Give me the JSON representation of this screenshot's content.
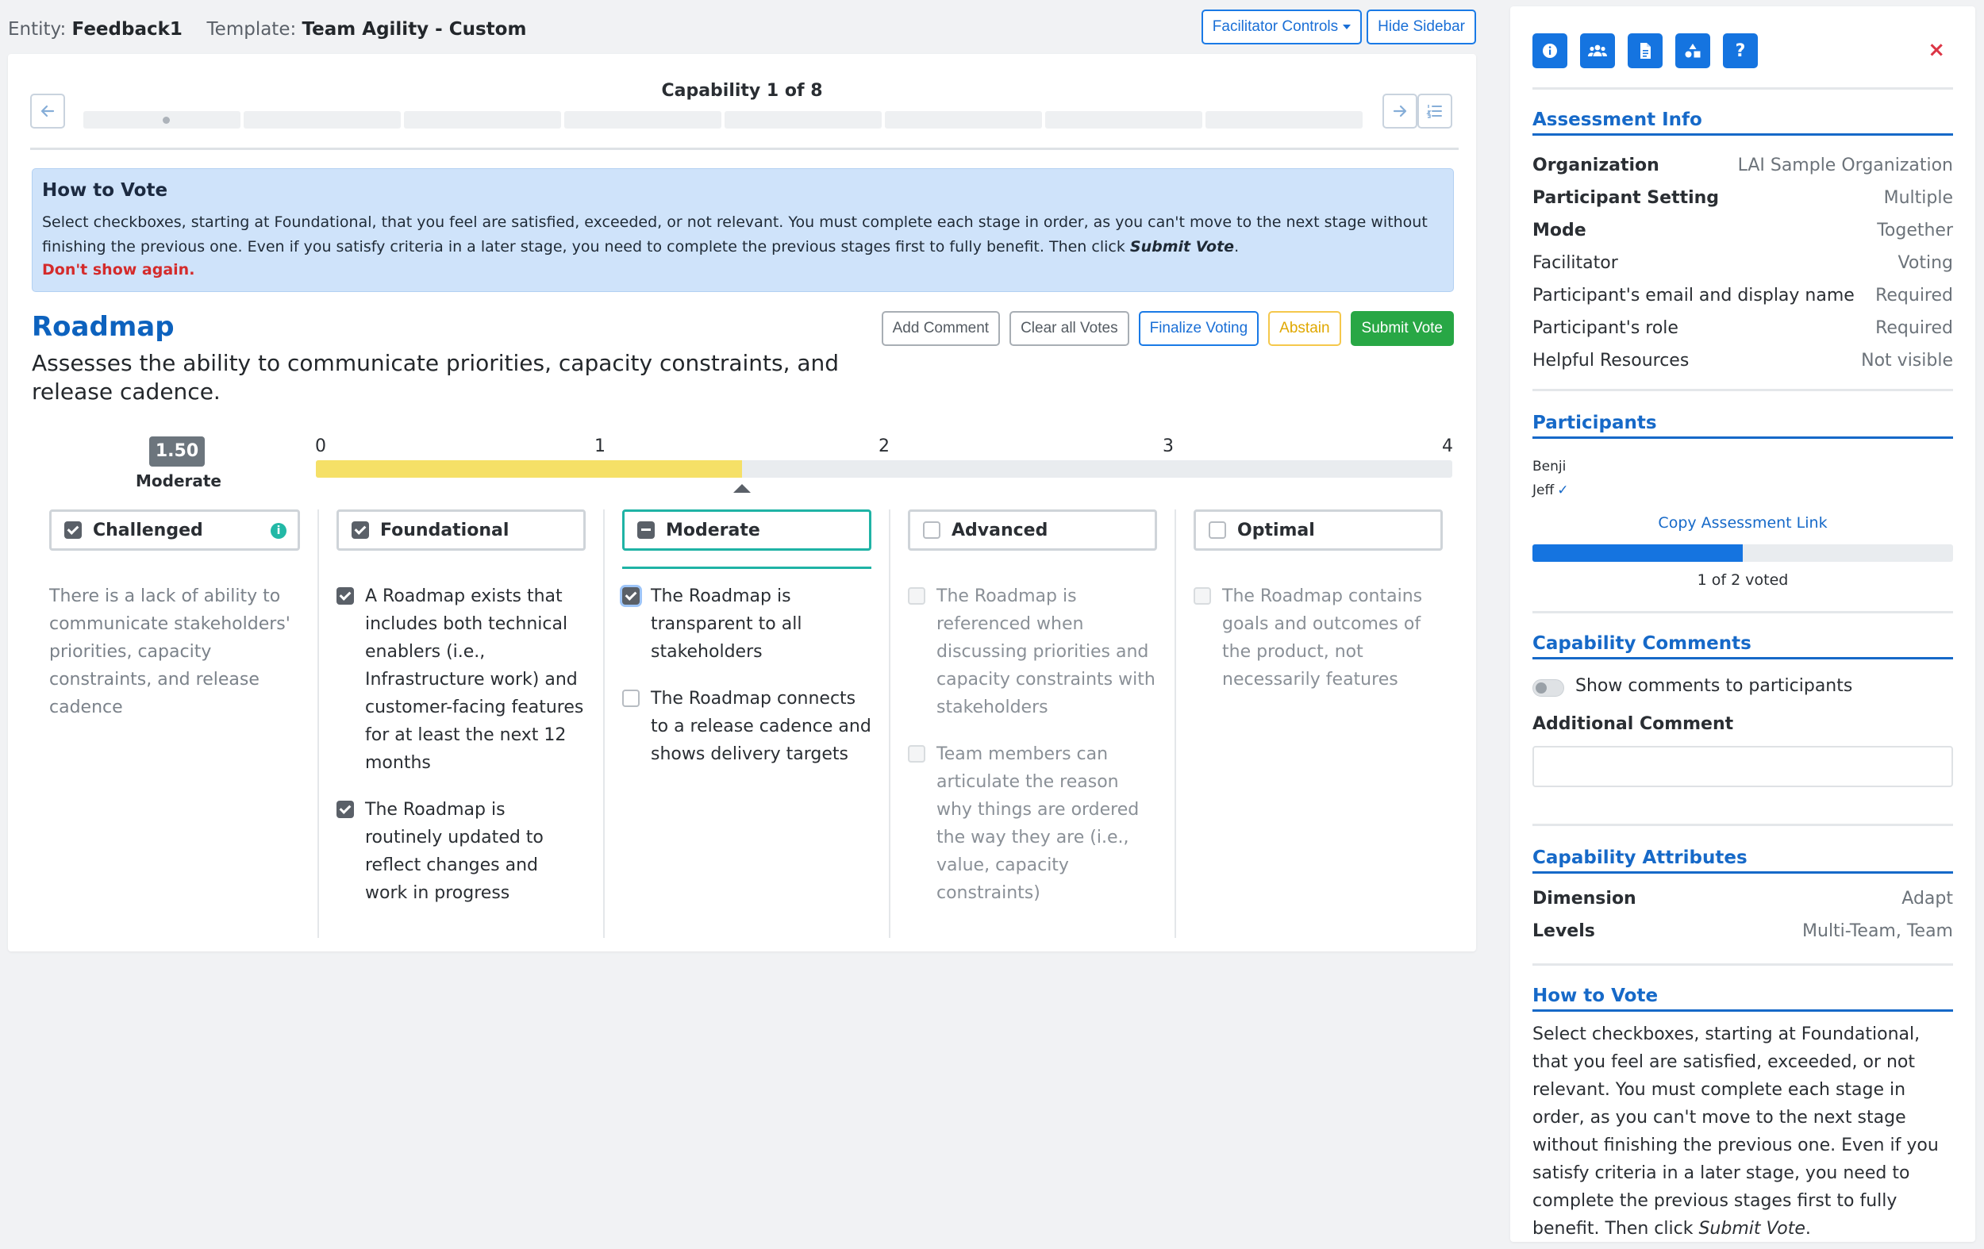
{
  "header": {
    "entity_label": "Entity:",
    "entity_value": "Feedback1",
    "template_label": "Template:",
    "template_value": "Team Agility - Custom",
    "facilitator_controls": "Facilitator Controls",
    "hide_sidebar": "Hide Sidebar"
  },
  "main": {
    "capability_counter": "Capability 1 of 8",
    "progress": {
      "segments": 8,
      "current": 1
    },
    "how_to_vote": {
      "title": "How to Vote",
      "text": "Select checkboxes, starting at Foundational, that you feel are satisfied, exceeded, or not relevant. You must complete each stage in order, as you can't move to the next stage without finishing the previous one. Even if you satisfy criteria in a later stage, you need to complete the previous stages first to fully benefit. Then click ",
      "emph": "Submit Vote",
      "end": ".",
      "dismiss": "Don't show again."
    },
    "capability_name": "Roadmap",
    "capability_description": "Assesses the ability to communicate priorities, capacity constraints, and release cadence.",
    "buttons": {
      "add_comment": "Add Comment",
      "clear_votes": "Clear all Votes",
      "finalize": "Finalize Voting",
      "abstain": "Abstain",
      "submit": "Submit Vote"
    },
    "score": {
      "value": "1.50",
      "label": "Moderate",
      "numeric": 1.5,
      "scale_min": 0,
      "scale_max": 4,
      "ticks": [
        "0",
        "1",
        "2",
        "3",
        "4"
      ]
    },
    "columns": [
      {
        "name": "Challenged",
        "state": "checked",
        "has_info": true,
        "info_glyph": "i",
        "description": "There is a lack of ability to communicate stakeholders' priorities, capacity constraints, and release cadence",
        "criteria": []
      },
      {
        "name": "Foundational",
        "state": "checked",
        "criteria": [
          {
            "text": "A Roadmap exists that includes both technical enablers (i.e., Infrastructure work) and customer-facing features for at least the next 12 months",
            "state": "checked"
          },
          {
            "text": "The Roadmap is routinely updated to reflect changes and work in progress",
            "state": "checked"
          }
        ]
      },
      {
        "name": "Moderate",
        "state": "partial",
        "active": true,
        "criteria": [
          {
            "text": "The Roadmap is transparent to all stakeholders",
            "state": "checked-focused"
          },
          {
            "text": "The Roadmap connects to a release cadence and shows delivery targets",
            "state": "empty"
          }
        ]
      },
      {
        "name": "Advanced",
        "state": "empty",
        "criteria": [
          {
            "text": "The Roadmap is referenced when discussing priorities and capacity constraints with stakeholders",
            "state": "disabled"
          },
          {
            "text": "Team members can articulate the reason why things are ordered the way they are (i.e., value, capacity constraints)",
            "state": "disabled"
          }
        ]
      },
      {
        "name": "Optimal",
        "state": "empty",
        "criteria": [
          {
            "text": "The Roadmap contains goals and outcomes of the product, not necessarily features",
            "state": "disabled"
          }
        ]
      }
    ]
  },
  "sidebar": {
    "icons": [
      "info-icon",
      "users-icon",
      "document-icon",
      "shapes-icon",
      "help-icon"
    ],
    "help_glyph": "?",
    "close_glyph": "×",
    "assessment_info": {
      "title": "Assessment Info",
      "rows": [
        {
          "k": "Organization",
          "v": "LAI Sample Organization",
          "bold": true
        },
        {
          "k": "Participant Setting",
          "v": "Multiple",
          "bold": true
        },
        {
          "k": "Mode",
          "v": "Together",
          "bold": true
        },
        {
          "k": "Facilitator",
          "v": "Voting",
          "bold": false
        },
        {
          "k": "Participant's email and display name",
          "v": "Required",
          "bold": false
        },
        {
          "k": "Participant's role",
          "v": "Required",
          "bold": false
        },
        {
          "k": "Helpful Resources",
          "v": "Not visible",
          "bold": false
        }
      ]
    },
    "participants": {
      "title": "Participants",
      "list": [
        {
          "name": "Benji",
          "voted": false
        },
        {
          "name": "Jeff",
          "voted": true
        }
      ],
      "check_glyph": "✓",
      "copy_link": "Copy Assessment Link",
      "voted_fraction": 0.5,
      "voted_text": "1 of 2 voted"
    },
    "capability_comments": {
      "title": "Capability Comments",
      "toggle_label": "Show comments to participants",
      "toggle_on": false,
      "additional_label": "Additional Comment",
      "additional_value": ""
    },
    "capability_attributes": {
      "title": "Capability Attributes",
      "rows": [
        {
          "k": "Dimension",
          "v": "Adapt"
        },
        {
          "k": "Levels",
          "v": "Multi-Team, Team"
        }
      ]
    },
    "how_to_vote": {
      "title": "How to Vote",
      "text": "Select checkboxes, starting at Foundational, that you feel are satisfied, exceeded, or not relevant. You must complete each stage in order, as you can't move to the next stage without finishing the previous one. Even if you satisfy criteria in a later stage, you need to complete the previous stages first to fully benefit. Then click ",
      "emph": "Submit Vote",
      "end": "."
    }
  },
  "colors": {
    "primary": "#1574e0",
    "teal": "#1fb3a5",
    "success": "#28a745",
    "warning": "#f5c84c",
    "danger": "#dc3545",
    "score_fill": "#f5e067",
    "info_bg": "#cfe3fa"
  }
}
